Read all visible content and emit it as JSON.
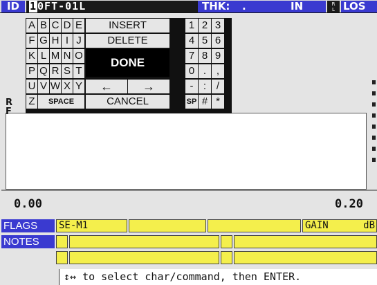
{
  "top": {
    "id_label": "ID",
    "id_cursor_char": "1",
    "id_rest": "0FT-01L",
    "thk_label": "THK:",
    "thk_value": ".",
    "thk_unit": "IN",
    "rl_top": "R",
    "rl_bottom": "L",
    "los_label": "LOS"
  },
  "keyboard": {
    "letters": [
      [
        "A",
        "B",
        "C",
        "D",
        "E"
      ],
      [
        "F",
        "G",
        "H",
        "I",
        "J"
      ],
      [
        "K",
        "L",
        "M",
        "N",
        "O"
      ],
      [
        "P",
        "Q",
        "R",
        "S",
        "T"
      ],
      [
        "U",
        "V",
        "W",
        "X",
        "Y"
      ]
    ],
    "z_key": "Z",
    "space_label": "SPACE",
    "insert_label": "INSERT",
    "delete_label": "DELETE",
    "done_label": "DONE",
    "left_arrow": "←",
    "right_arrow": "→",
    "cancel_label": "CANCEL",
    "symbols": [
      [
        "1",
        "2",
        "3"
      ],
      [
        "4",
        "5",
        "6"
      ],
      [
        "7",
        "8",
        "9"
      ],
      [
        "0",
        ".",
        ","
      ],
      [
        "-",
        ":",
        "/"
      ],
      [
        "SP",
        "#",
        "*"
      ]
    ]
  },
  "graph": {
    "side_label_top": "R",
    "side_label_bottom": "F",
    "axis_min": "0.00",
    "axis_max": "0.20"
  },
  "flags": {
    "label": "FLAGS",
    "field1": "SE-M1",
    "field2": "",
    "field3": "",
    "gain_label": "GAIN",
    "gain_unit": "dB"
  },
  "notes": {
    "label": "NOTES"
  },
  "status": {
    "hint": "↕↔ to select char/command, then ENTER."
  }
}
